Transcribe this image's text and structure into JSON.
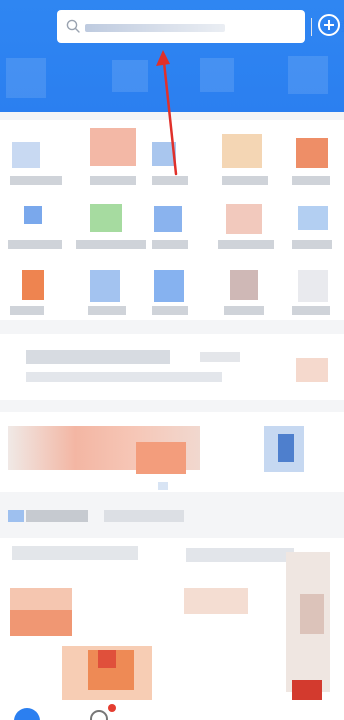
{
  "search": {
    "placeholder": "",
    "button_label": "搜索"
  },
  "watermark": "",
  "colors": {
    "brand": "#2b7ff0",
    "annotation_arrow": "#e0302a",
    "badge": "#e43d30"
  },
  "icons": {
    "search": "search-icon",
    "add": "plus-circle-icon",
    "annotation": "arrow-icon"
  }
}
